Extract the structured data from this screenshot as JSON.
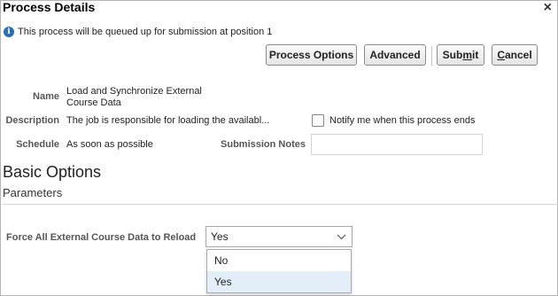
{
  "dialog": {
    "title": "Process Details",
    "close_label": "×",
    "info_text": "This process will be queued up for submission at position 1"
  },
  "buttons": {
    "process_options": "Process Options",
    "advanced": "Advanced",
    "submit": "Submit",
    "cancel": "Cancel"
  },
  "details": {
    "name_label": "Name",
    "name_line1": "Load and Synchronize External",
    "name_line2": "Course Data",
    "description_label": "Description",
    "description_value": "The job is responsible for loading the availabl...",
    "schedule_label": "Schedule",
    "schedule_value": "As soon as possible",
    "notify_label": "Notify me when this process ends",
    "notify_checked": false,
    "submission_notes_label": "Submission Notes",
    "submission_notes_value": ""
  },
  "basic_options": {
    "heading": "Basic Options",
    "parameters_heading": "Parameters",
    "force_reload_label": "Force All External Course Data to Reload",
    "force_reload_value": "Yes",
    "options": [
      "No",
      "Yes"
    ],
    "highlighted_option": "Yes"
  },
  "colors": {
    "info_icon": "#2d6db5",
    "highlight": "#e4eef8",
    "border": "#b5b5b5"
  },
  "icons": {
    "info": "info-icon",
    "close": "close-icon",
    "dropdown": "chevron-down-icon"
  }
}
